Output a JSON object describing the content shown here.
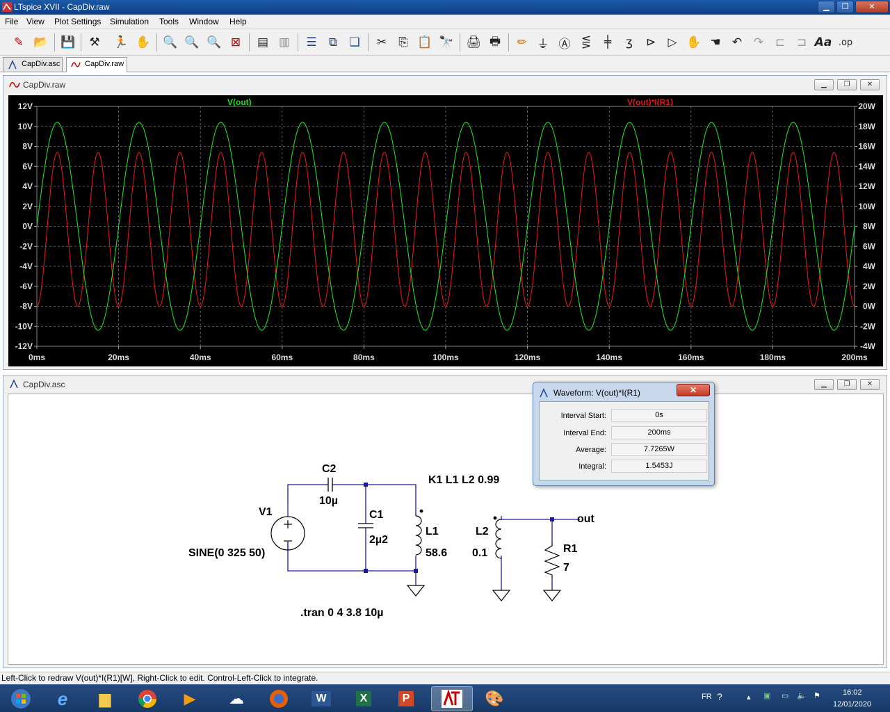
{
  "window": {
    "title": "LTspice XVII - CapDiv.raw"
  },
  "menu": [
    "File",
    "View",
    "Plot Settings",
    "Simulation",
    "Tools",
    "Window",
    "Help"
  ],
  "tabs": [
    {
      "label": "CapDiv.asc"
    },
    {
      "label": "CapDiv.raw"
    }
  ],
  "plot_window": {
    "title": "CapDiv.raw"
  },
  "schematic_window": {
    "title": "CapDiv.asc"
  },
  "chart_data": {
    "type": "line",
    "x_ticks": [
      "0ms",
      "20ms",
      "40ms",
      "60ms",
      "80ms",
      "100ms",
      "120ms",
      "140ms",
      "160ms",
      "180ms",
      "200ms"
    ],
    "y_left_ticks": [
      "12V",
      "10V",
      "8V",
      "6V",
      "4V",
      "2V",
      "0V",
      "-2V",
      "-4V",
      "-6V",
      "-8V",
      "-10V",
      "-12V"
    ],
    "y_right_ticks": [
      "20W",
      "18W",
      "16W",
      "14W",
      "12W",
      "10W",
      "8W",
      "6W",
      "4W",
      "2W",
      "0W",
      "-2W",
      "-4W"
    ],
    "xlim": [
      0,
      200
    ],
    "ylim_left": [
      -12,
      12
    ],
    "ylim_right": [
      -4,
      20
    ],
    "grid": true,
    "series": [
      {
        "name": "V(out)",
        "color": "#22dd22",
        "axis": "left",
        "amplitude_V": 10.4,
        "freq_Hz": 50,
        "phase_note": "starts near 0V rising, peak at 5ms"
      },
      {
        "name": "V(out)*I(R1)",
        "color": "#e01818",
        "axis": "right",
        "min_W": 0,
        "max_W": 15.4,
        "freq_Hz": 100
      }
    ]
  },
  "dialog": {
    "title": "Waveform: V(out)*I(R1)",
    "rows": [
      {
        "label": "Interval Start:",
        "value": "0s"
      },
      {
        "label": "Interval End:",
        "value": "200ms"
      },
      {
        "label": "Average:",
        "value": "7.7265W"
      },
      {
        "label": "Integral:",
        "value": "1.5453J"
      }
    ]
  },
  "schematic": {
    "v1": "V1",
    "v1_value": "SINE(0 325 50)",
    "c2": "C2",
    "c2_value": "10µ",
    "c1": "C1",
    "c1_value": "2µ2",
    "l1": "L1",
    "l1_value": "58.6",
    "l2": "L2",
    "l2_value": "0.1",
    "r1": "R1",
    "r1_value": "7",
    "k1": "K1 L1 L2 0.99",
    "net_out": "out",
    "tran": ".tran 0 4 3.8 10µ"
  },
  "status": "Left-Click to redraw V(out)*I(R1)[W],  Right-Click to edit. Control-Left-Click to integrate.",
  "tray": {
    "lang": "FR",
    "time": "16:02",
    "date": "12/01/2020"
  }
}
